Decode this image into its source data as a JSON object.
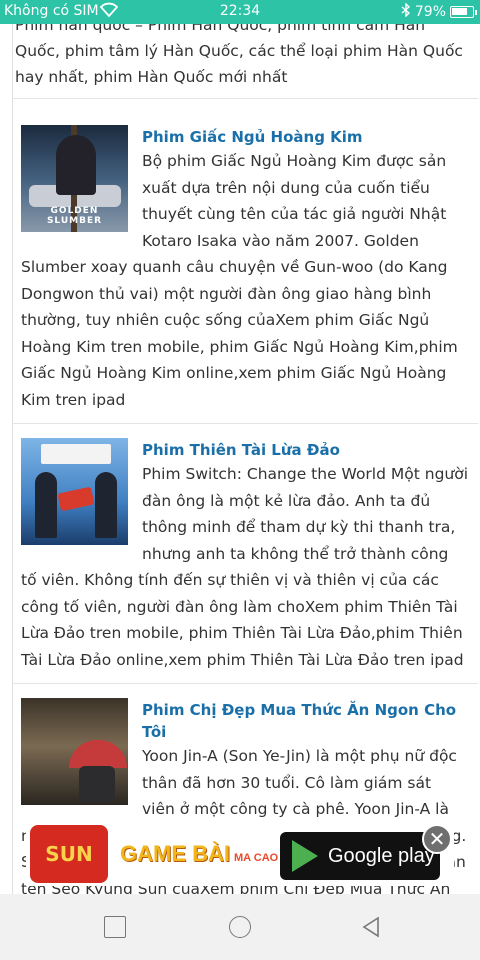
{
  "status_bar": {
    "carrier": "Không có SIM",
    "time": "22:34",
    "battery": "79%",
    "battery_level": 0.79
  },
  "intro_text": "Phim hàn quốc – Phim Hàn Quốc, phim tình cảm Hàn Quốc, phim tâm lý Hàn Quốc, các thể loại phim Hàn Quốc hay nhất, phim Hàn Quốc mới nhất",
  "articles": [
    {
      "title": "Phim Giấc Ngủ Hoàng Kim",
      "description": "Bộ phim Giấc Ngủ Hoàng Kim được sản xuất dựa trên nội dung của cuốn tiểu thuyết cùng tên của tác giả người Nhật Kotaro Isaka vào năm 2007. Golden Slumber xoay quanh câu chuyện về Gun-woo (do Kang Dongwon thủ vai) một người đàn ông giao hàng bình thường, tuy nhiên cuộc sống củaXem phim Giấc Ngủ Hoàng Kim tren mobile, phim Giấc Ngủ Hoàng Kim,phim Giấc Ngủ Hoàng Kim online,xem phim Giấc Ngủ Hoàng Kim tren ipad",
      "thumb_caption": "GOLDEN SLUMBER"
    },
    {
      "title": "Phim Thiên Tài Lừa Đảo",
      "description": "Phim Switch: Change the World Một người đàn ông là một kẻ lừa đảo. Anh ta đủ thông minh để tham dự kỳ thi thanh tra, nhưng anh ta không thể trở thành công tố viên. Không tính đến sự thiên vị và thiên vị của các công tố viên, người đàn ông làm choXem phim Thiên Tài Lừa Đảo tren mobile, phim Thiên Tài Lừa Đảo,phim Thiên Tài Lừa Đảo online,xem phim Thiên Tài Lừa Đảo tren ipad"
    },
    {
      "title": "Phim Chị Đẹp Mua Thức Ăn Ngon Cho Tôi",
      "description": "Yoon Jin-A (Son Ye-Jin) là một phụ nữ độc thân đã hơn 30 tuổi. Cô làm giám sát viên ở một công ty cà phê. Yoon Jin-A là một người vô tư nhưng cô luôn thấy trống trải trong lòng. Seo Joon-Hee (Jung Hae-In) là em trai của người bạn thân tên Seo Kyung Sun củaXem phim Chị Đẹp Mua Thức Ăn Ngon Cho Tôi tren mobile, phim Chị Đẹp Mua Thức Ăn Ngon Cho Tôi"
    }
  ],
  "ad": {
    "logo_text": "SUN",
    "headline": "GAME BÀI",
    "subline": "MA CAO",
    "play_label": "Google play",
    "close_glyph": "✕"
  },
  "nav": {
    "recents_icon": "square-icon",
    "home_icon": "circle-icon",
    "back_icon": "triangle-back-icon"
  }
}
